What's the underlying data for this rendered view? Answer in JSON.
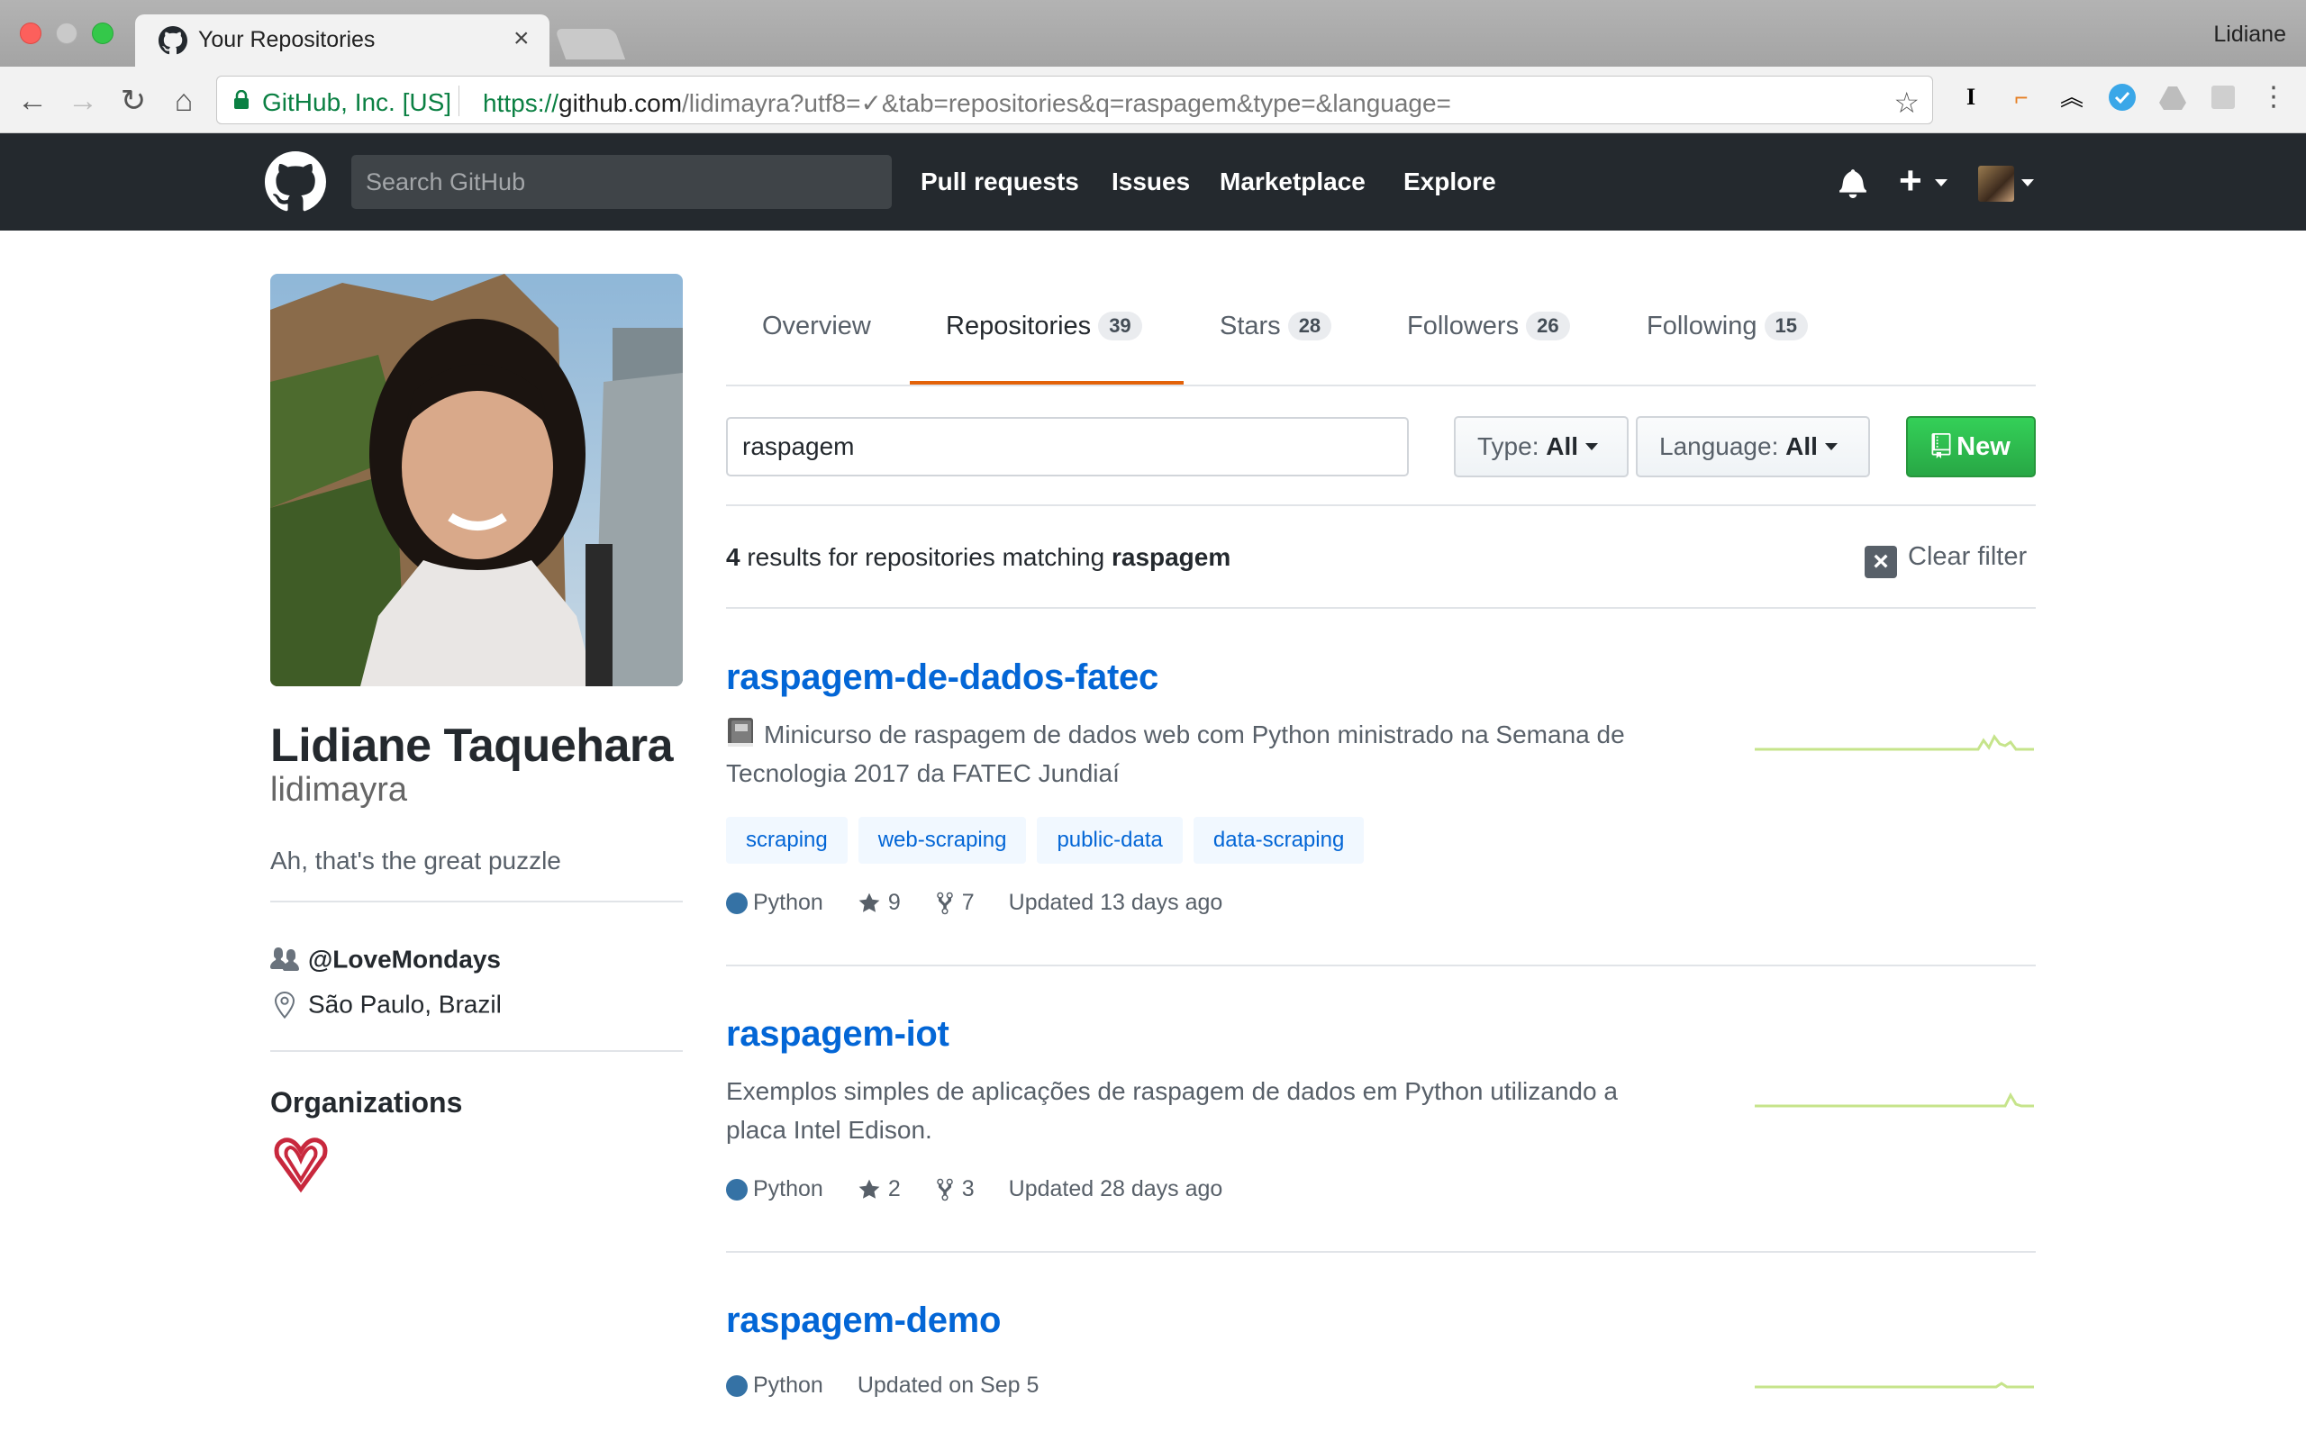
{
  "browser": {
    "tab_title": "Your Repositories",
    "tab_close": "×",
    "profile_name": "Lidiane",
    "security_label": "GitHub, Inc. [US]",
    "url_scheme": "https://",
    "url_host": "github.com",
    "url_path": "/lidimayra?utf8=✓&tab=repositories&q=raspagem&type=&language="
  },
  "header": {
    "search_placeholder": "Search GitHub",
    "nav": [
      "Pull requests",
      "Issues",
      "Marketplace",
      "Explore"
    ]
  },
  "profile": {
    "full_name": "Lidiane Taquehara",
    "username": "lidimayra",
    "bio": "Ah, that's the great puzzle",
    "company": "@LoveMondays",
    "location": "São Paulo, Brazil",
    "organizations_title": "Organizations"
  },
  "tabs": {
    "overview": "Overview",
    "repositories": "Repositories",
    "repositories_count": "39",
    "stars": "Stars",
    "stars_count": "28",
    "followers": "Followers",
    "followers_count": "26",
    "following": "Following",
    "following_count": "15"
  },
  "filter": {
    "query": "raspagem",
    "type_label": "Type:",
    "type_value": "All",
    "language_label": "Language:",
    "language_value": "All",
    "new_label": "New"
  },
  "results": {
    "count": "4",
    "text": "results for repositories matching",
    "query": "raspagem",
    "clear_label": "Clear filter"
  },
  "repos": [
    {
      "name": "raspagem-de-dados-fatec",
      "description": "Minicurso de raspagem de dados web com Python ministrado na Semana de Tecnologia 2017 da FATEC Jundiaí",
      "has_emoji": true,
      "topics": [
        "scraping",
        "web-scraping",
        "public-data",
        "data-scraping"
      ],
      "language": "Python",
      "stars": "9",
      "forks": "7",
      "updated": "Updated 13 days ago"
    },
    {
      "name": "raspagem-iot",
      "description": "Exemplos simples de aplicações de raspagem de dados em Python utilizando a placa Intel Edison.",
      "has_emoji": false,
      "topics": [],
      "language": "Python",
      "stars": "2",
      "forks": "3",
      "updated": "Updated 28 days ago"
    },
    {
      "name": "raspagem-demo",
      "description": "",
      "has_emoji": false,
      "topics": [],
      "language": "Python",
      "stars": "",
      "forks": "",
      "updated": "Updated on Sep 5"
    }
  ],
  "colors": {
    "python": "#3572A5",
    "link": "#0366d6",
    "tab_underline": "#e36209",
    "new_button": "#28a745",
    "sparkline": "#c6e48b"
  }
}
